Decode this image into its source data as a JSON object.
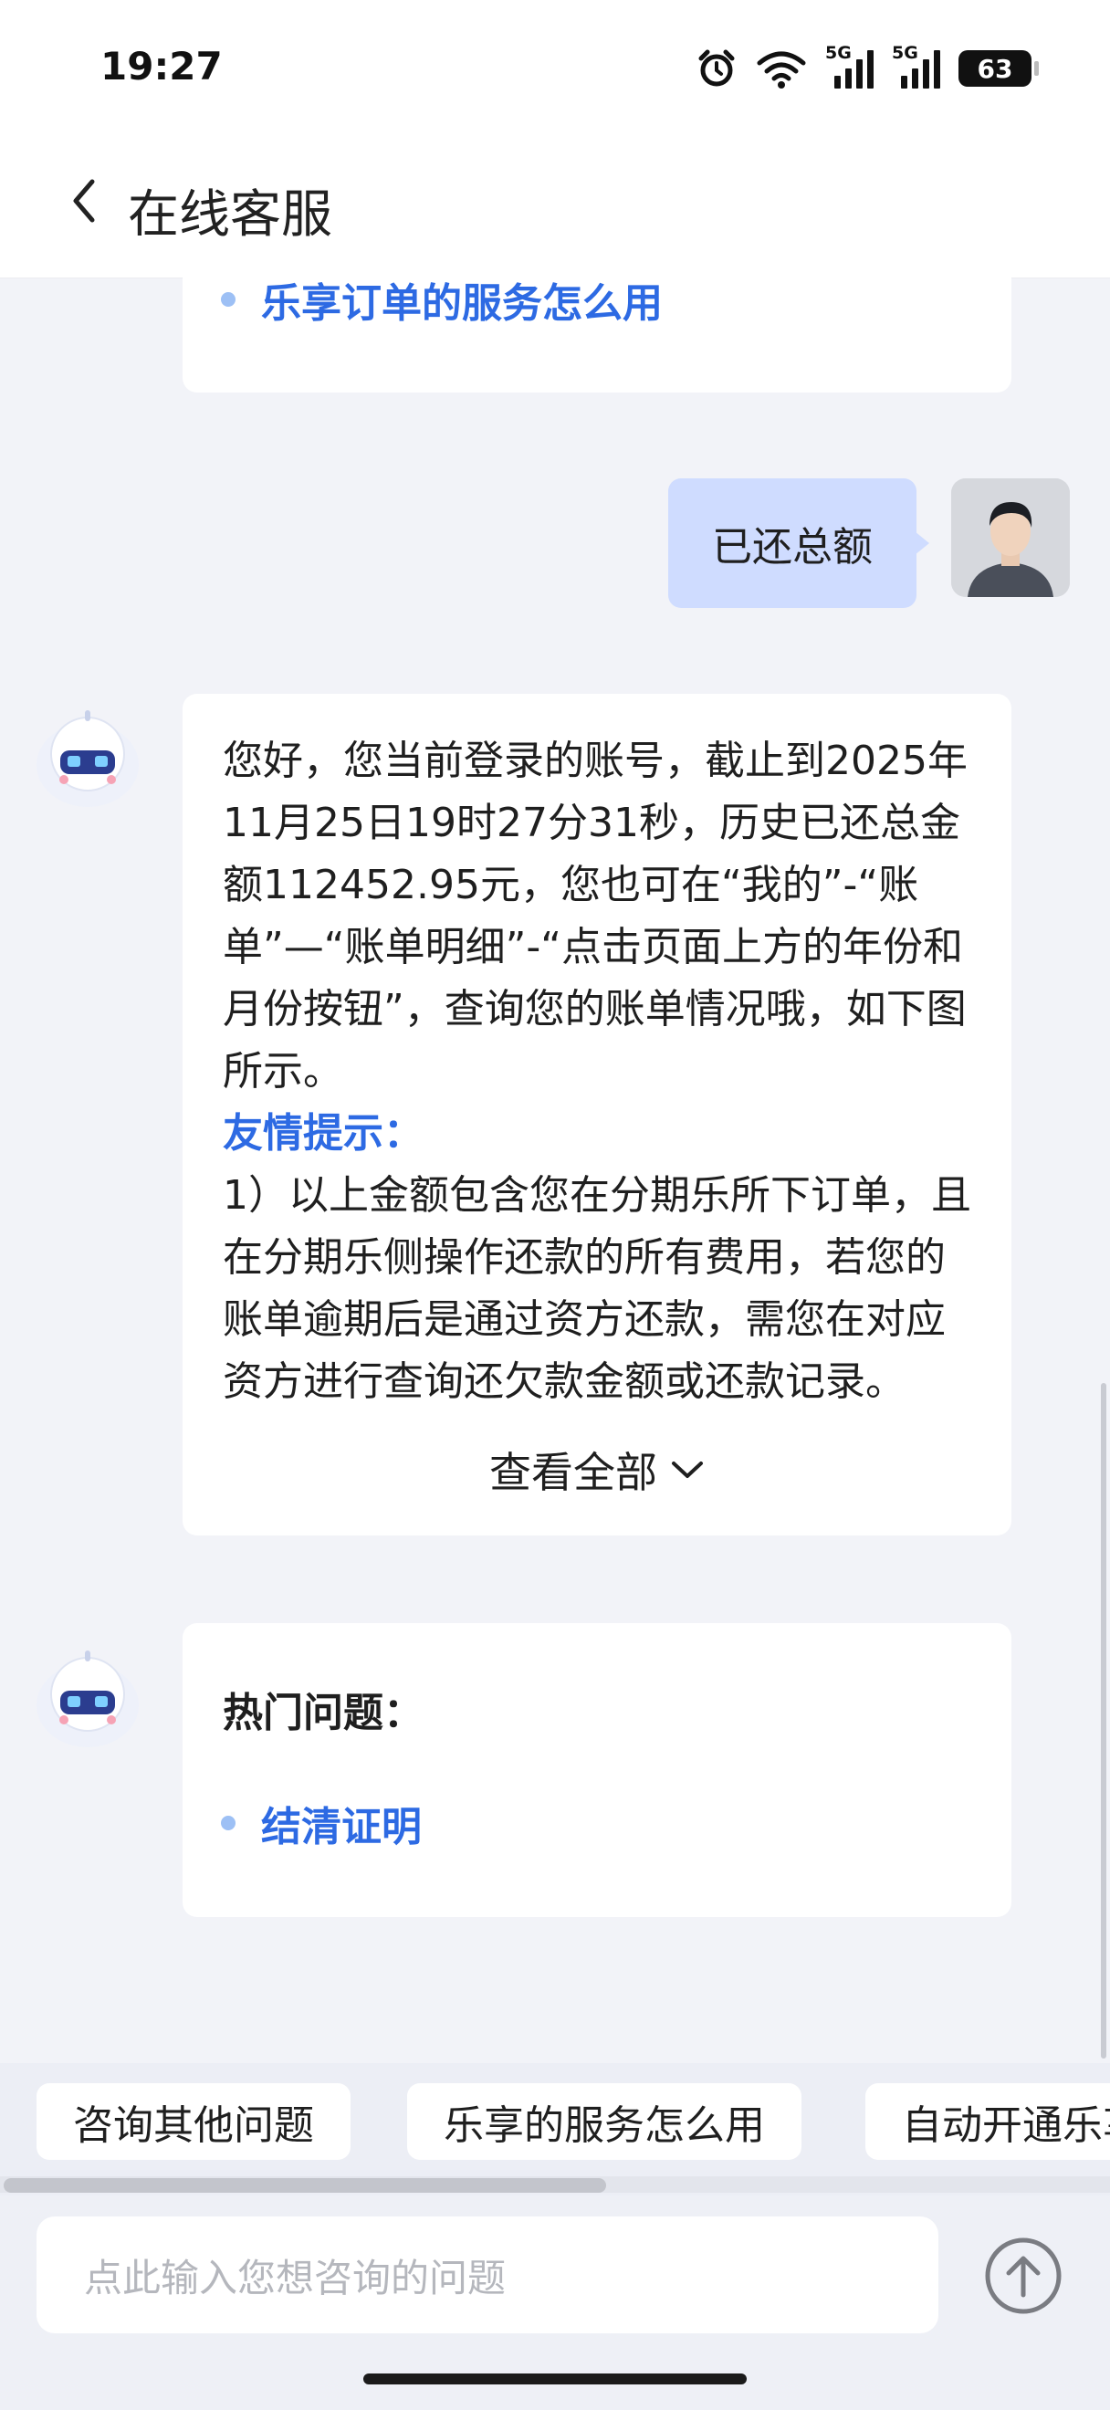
{
  "status_bar": {
    "time": "19:27",
    "signal_1_label": "5G",
    "signal_2_label": "5G",
    "battery": "63"
  },
  "header": {
    "title": "在线客服"
  },
  "previous_card": {
    "link_label": "乐享订单的服务怎么用"
  },
  "user_message": {
    "text": "已还总额"
  },
  "bot_answer": {
    "paragraph": "您好，您当前登录的账号，截止到2025年11月25日19时27分31秒，历史已还总金额112452.95元，您也可在“我的”-“账单”—“账单明细”-“点击页面上方的年份和月份按钮”，查询您的账单情况哦，如下图所示。",
    "tip_title": "友情提示：",
    "tip_text": "1）以上金额包含您在分期乐所下订单，且在分期乐侧操作还款的所有费用，若您的账单逾期后是通过资方还款，需您在对应资方进行查询还欠款金额或还款记录。",
    "expand_label": "查看全部"
  },
  "hot_questions": {
    "title": "热门问题：",
    "items": [
      "结清证明"
    ]
  },
  "quick_chips": [
    "咨询其他问题",
    "乐享的服务怎么用",
    "自动开通乐享"
  ],
  "input": {
    "placeholder": "点此输入您想咨询的问题"
  },
  "colors": {
    "accent": "#2d6ae3",
    "user_bubble": "#cfdcff",
    "background": "#f2f3f8"
  }
}
